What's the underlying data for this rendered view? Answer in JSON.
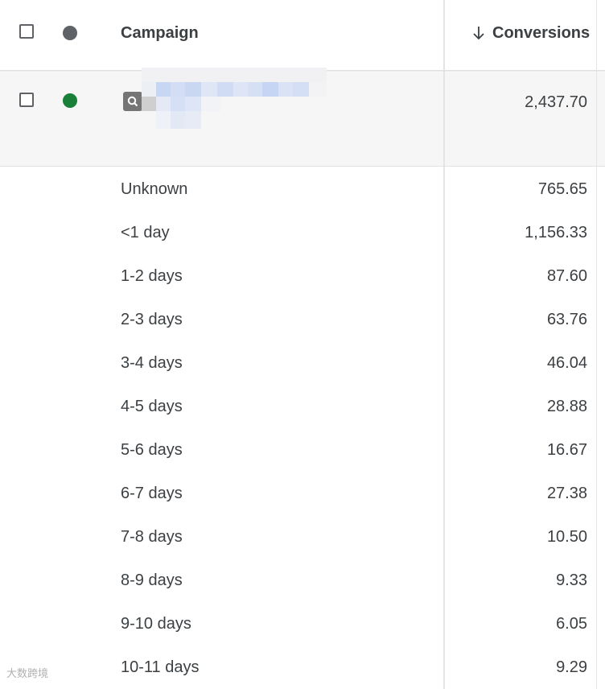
{
  "header": {
    "campaign_label": "Campaign",
    "conversions_label": "Conversions",
    "status_color": "#5f6368"
  },
  "campaign": {
    "status_color": "#188038",
    "type_icon": "search-icon",
    "name_redacted": true,
    "conversions": "2,437.70"
  },
  "segments": [
    {
      "label": "Unknown",
      "value": "765.65"
    },
    {
      "label": "<1 day",
      "value": "1,156.33"
    },
    {
      "label": "1-2 days",
      "value": "87.60"
    },
    {
      "label": "2-3 days",
      "value": "63.76"
    },
    {
      "label": "3-4 days",
      "value": "46.04"
    },
    {
      "label": "4-5 days",
      "value": "28.88"
    },
    {
      "label": "5-6 days",
      "value": "16.67"
    },
    {
      "label": "6-7 days",
      "value": "27.38"
    },
    {
      "label": "7-8 days",
      "value": "10.50"
    },
    {
      "label": "8-9 days",
      "value": "9.33"
    },
    {
      "label": "9-10 days",
      "value": "6.05"
    },
    {
      "label": "10-11 days",
      "value": "9.29"
    }
  ],
  "watermark": "大数跨境"
}
